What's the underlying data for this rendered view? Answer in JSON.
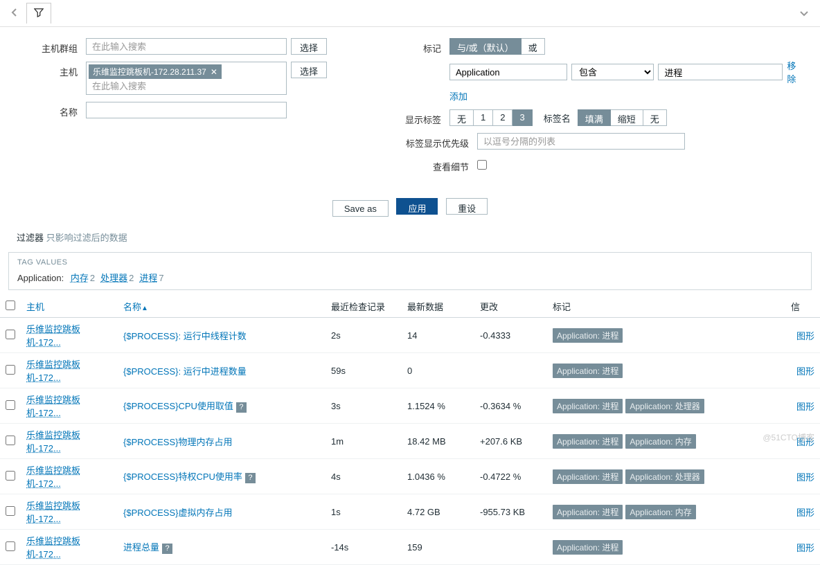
{
  "filter": {
    "host_group": {
      "label": "主机群组",
      "placeholder": "在此输入搜索",
      "select_btn": "选择"
    },
    "host": {
      "label": "主机",
      "tag": "乐维监控跳板机-172.28.211.37",
      "placeholder": "在此输入搜索",
      "select_btn": "选择"
    },
    "name": {
      "label": "名称"
    },
    "tags_label": "标记",
    "tag_mode": {
      "andor": "与/或（默认）",
      "or": "或"
    },
    "tag_rule": {
      "key": "Application",
      "op": "包含",
      "val": "进程",
      "remove": "移除"
    },
    "add_link": "添加",
    "show_tags": {
      "label": "显示标签",
      "none": "无",
      "one": "1",
      "two": "2",
      "three": "3"
    },
    "tag_name": {
      "label": "标签名",
      "full": "填满",
      "short": "缩短",
      "none": "无"
    },
    "priority": {
      "label": "标签显示优先级",
      "placeholder": "以逗号分隔的列表"
    },
    "details": {
      "label": "查看细节"
    },
    "actions": {
      "save_as": "Save as",
      "apply": "应用",
      "reset": "重设"
    }
  },
  "filters_line": {
    "label": "过滤器",
    "hint": "只影响过滤后的数据"
  },
  "tag_values": {
    "title": "TAG VALUES",
    "key": "Application:",
    "items": [
      {
        "name": "内存",
        "count": "2"
      },
      {
        "name": "处理器",
        "count": "2"
      },
      {
        "name": "进程",
        "count": "7"
      }
    ]
  },
  "table": {
    "headers": {
      "host": "主机",
      "name": "名称",
      "last_check": "最近检查记录",
      "last_data": "最新数据",
      "change": "更改",
      "tags": "标记",
      "info": "信"
    },
    "graph_link": "图形",
    "rows": [
      {
        "host": "乐维监控跳板机-172...",
        "name": "{$PROCESS}: 运行中线程计数",
        "help": false,
        "last": "2s",
        "data": "14",
        "change": "-0.4333",
        "tags": [
          "Application: 进程"
        ]
      },
      {
        "host": "乐维监控跳板机-172...",
        "name": "{$PROCESS}: 运行中进程数量",
        "help": false,
        "last": "59s",
        "data": "0",
        "change": "",
        "tags": [
          "Application: 进程"
        ]
      },
      {
        "host": "乐维监控跳板机-172...",
        "name": "{$PROCESS}CPU使用取值",
        "help": true,
        "last": "3s",
        "data": "1.1524 %",
        "change": "-0.3634 %",
        "tags": [
          "Application: 进程",
          "Application: 处理器"
        ]
      },
      {
        "host": "乐维监控跳板机-172...",
        "name": "{$PROCESS}物理内存占用",
        "help": false,
        "last": "1m",
        "data": "18.42 MB",
        "change": "+207.6 KB",
        "tags": [
          "Application: 进程",
          "Application: 内存"
        ]
      },
      {
        "host": "乐维监控跳板机-172...",
        "name": "{$PROCESS}特权CPU使用率",
        "help": true,
        "last": "4s",
        "data": "1.0436 %",
        "change": "-0.4722 %",
        "tags": [
          "Application: 进程",
          "Application: 处理器"
        ]
      },
      {
        "host": "乐维监控跳板机-172...",
        "name": "{$PROCESS}虚拟内存占用",
        "help": false,
        "last": "1s",
        "data": "4.72 GB",
        "change": "-955.73 KB",
        "tags": [
          "Application: 进程",
          "Application: 内存"
        ]
      },
      {
        "host": "乐维监控跳板机-172...",
        "name": "进程总量",
        "help": true,
        "last": "-14s",
        "data": "159",
        "change": "",
        "tags": [
          "Application: 进程"
        ]
      }
    ]
  },
  "watermark": "@51CTO博客"
}
